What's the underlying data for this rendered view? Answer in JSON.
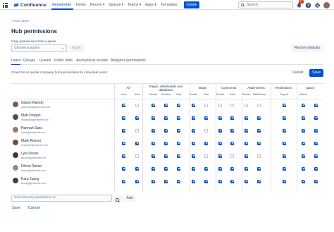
{
  "topnav": {
    "logo_text": "Confluence",
    "items": [
      {
        "label": "Globetrotter",
        "active": true
      },
      {
        "label": "Home"
      },
      {
        "label": "Recent ▾"
      },
      {
        "label": "Spaces ▾"
      },
      {
        "label": "Teams ▾"
      },
      {
        "label": "Apps ▾"
      },
      {
        "label": "Templates"
      }
    ],
    "create_label": "Create",
    "search_placeholder": "Search",
    "notification_count": "9+"
  },
  "breadcrumb": "Hub name",
  "page_title": "Hub permissions",
  "copy": {
    "label": "Copy permissions from a space",
    "select_placeholder": "Choose a space",
    "apply_label": "Apply",
    "restore_label": "Restore defaults"
  },
  "tabs": [
    "Users",
    "Groups",
    "Guests",
    "Public links",
    "Anonymous access",
    "Analytics permissions"
  ],
  "grant_text": "Grant full or partial company hub permissions to individual users.",
  "actions": {
    "cancel": "Cancel",
    "save": "Save"
  },
  "table": {
    "groups": [
      {
        "label": "All",
        "subs": [
          "View"
        ]
      },
      {
        "label": "Pages, whiteboards and databases",
        "subs": [
          "Add",
          "Delete",
          "Archive"
        ]
      },
      {
        "label": "Blogs",
        "subs": [
          "Add",
          "Delete"
        ]
      },
      {
        "label": "Comments",
        "subs": [
          "Add",
          "Delete"
        ]
      },
      {
        "label": "Attachments",
        "subs": [
          "Add",
          "Delete"
        ]
      },
      {
        "label": "Restrictions",
        "subs": [
          "Add/Delete"
        ]
      },
      {
        "label": "Space",
        "subs": [
          "Export",
          "Admin"
        ]
      }
    ],
    "users": [
      {
        "name": "Gianni Raindo",
        "email": "graimondo@globetrotter.com",
        "avatar": "#7a5c4f",
        "perms": [
          1,
          0,
          1,
          1,
          1,
          1,
          0,
          0,
          0,
          0,
          0,
          1,
          1,
          1
        ]
      },
      {
        "name": "Matt Dorgan",
        "email": "mdorgan@globetrotter.com",
        "avatar": "#5e4a3e",
        "perms": [
          1,
          1,
          1,
          1,
          1,
          1,
          1,
          1,
          1,
          1,
          1,
          1,
          1,
          1
        ]
      },
      {
        "name": "Hannah Sass",
        "email": "hsass@globetrotter.com",
        "avatar": "#9c7868",
        "perms": [
          1,
          0,
          1,
          1,
          1,
          1,
          0,
          1,
          1,
          1,
          1,
          1,
          1,
          1
        ]
      },
      {
        "name": "Mark Resser",
        "email": "mresser@globetrotter.com",
        "avatar": "#6b4f42",
        "perms": [
          1,
          1,
          1,
          1,
          1,
          1,
          1,
          1,
          1,
          1,
          1,
          1,
          1,
          1
        ]
      },
      {
        "name": "Lyla Dovas",
        "email": "ldovas@globetrotter.com",
        "avatar": "#3f3a36",
        "perms": [
          1,
          0,
          1,
          1,
          1,
          1,
          0,
          1,
          0,
          1,
          0,
          1,
          1,
          1
        ]
      },
      {
        "name": "Filene Razier",
        "email": "frazier@globetrotter.com",
        "avatar": "#a68673",
        "perms": [
          1,
          1,
          1,
          1,
          1,
          1,
          1,
          1,
          1,
          1,
          1,
          1,
          1,
          1
        ]
      },
      {
        "name": "Kara Juang",
        "email": "kjuang@globetrotter.com",
        "avatar": "#4a3b33",
        "perms": [
          1,
          1,
          1,
          1,
          1,
          1,
          1,
          1,
          1,
          1,
          1,
          1,
          1,
          1
        ]
      }
    ]
  },
  "grant_browse": {
    "placeholder": "Grant browse permission to",
    "add_label": "Add"
  },
  "bottom": {
    "save": "Save",
    "cancel": "Cancel"
  },
  "colors": {
    "primary": "#0052cc",
    "text": "#172b4d",
    "subtle": "#6b778c",
    "border": "#dfe1e6"
  }
}
